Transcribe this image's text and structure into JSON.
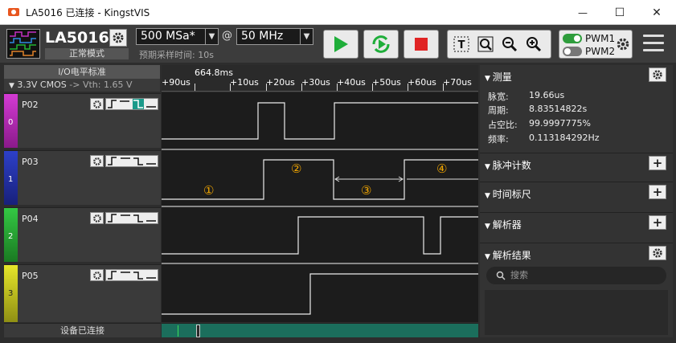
{
  "window": {
    "title": "LA5016 已连接 - KingstVIS",
    "minimize": "—",
    "maximize": "☐",
    "close": "✕"
  },
  "device": {
    "name": "LA5016",
    "mode": "正常模式"
  },
  "sample_rate": {
    "value": "500 MSa*",
    "at": "@"
  },
  "sample_count": {
    "value": "50 MHz"
  },
  "predicted_time": "预期采样时间: 10s",
  "pwm": {
    "pwm1": "PWM1",
    "pwm2": "PWM2",
    "pwm1_on": true,
    "pwm2_on": false
  },
  "io_panel": {
    "header": "I/O电平标准",
    "level": "3.3V CMOS",
    "arrow": "->",
    "vth": "Vth: 1.65 V"
  },
  "channels": [
    {
      "index": "0",
      "name": "P02",
      "color": "#c22fc2"
    },
    {
      "index": "1",
      "name": "P03",
      "color": "#2436b5"
    },
    {
      "index": "2",
      "name": "P04",
      "color": "#22b532"
    },
    {
      "index": "3",
      "name": "P05",
      "color": "#d2d21e"
    }
  ],
  "status": "设备已连接",
  "ruler": {
    "origin": "664.8ms",
    "ticks": [
      "+90us",
      "+10us",
      "+20us",
      "+30us",
      "+40us",
      "+50us",
      "+60us",
      "+70us"
    ]
  },
  "markers": [
    "①",
    "②",
    "③",
    "④"
  ],
  "right_panel": {
    "measure_title": "测量",
    "measurements": [
      {
        "label": "脉宽:",
        "value": "19.66us"
      },
      {
        "label": "周期:",
        "value": "8.83514822s"
      },
      {
        "label": "占空比:",
        "value": "99.9997775%"
      },
      {
        "label": "频率:",
        "value": "0.113184292Hz"
      }
    ],
    "pulse_count": "脉冲计数",
    "time_marker": "时间标尺",
    "analyzer": "解析器",
    "results": "解析结果",
    "search_placeholder": "搜索",
    "add": "+"
  },
  "colors": {
    "accent_green": "#1fae3a",
    "stop_red": "#e02424",
    "marker": "#f0a500",
    "overview": "#1b6e5c"
  }
}
